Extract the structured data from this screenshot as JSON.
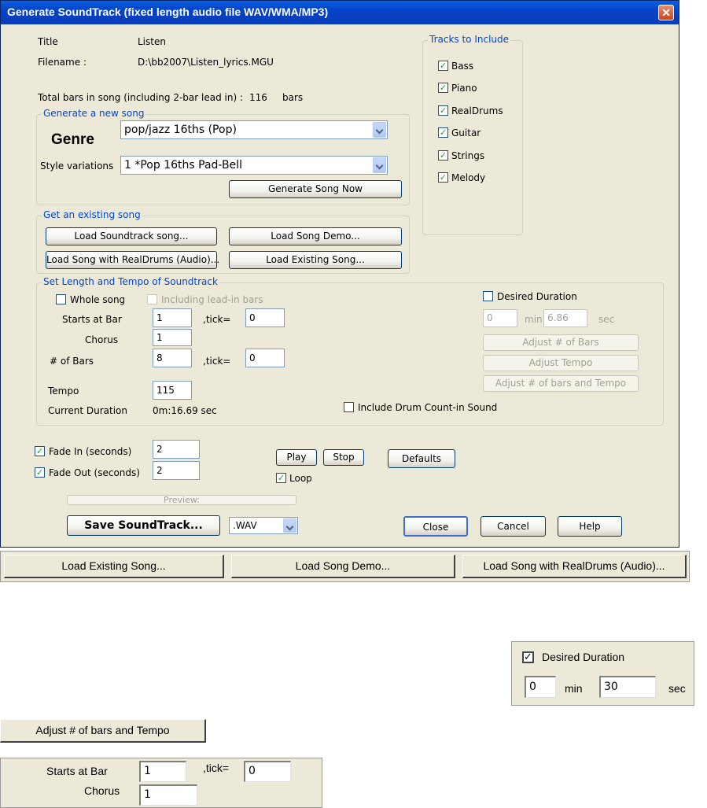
{
  "dialog": {
    "title": "Generate SoundTrack (fixed length audio file WAV/WMA/MP3)",
    "close_glyph": "✕",
    "title_label": "Title",
    "title_value": "Listen",
    "filename_label": "Filename :",
    "filename_value": "D:\\bb2007\\Listen_lyrics.MGU",
    "total_bars_label": "Total bars in song (including 2-bar lead in) :",
    "total_bars_value": "116",
    "total_bars_unit": "bars",
    "generate_group": {
      "legend": "Generate a new song",
      "genre_label": "Genre",
      "genre_value": "pop/jazz 16ths (Pop)",
      "style_label": "Style variations",
      "style_value": "1 *Pop 16ths Pad-Bell",
      "generate_button": "Generate Song Now"
    },
    "existing_group": {
      "legend": "Get an existing song",
      "load_soundtrack": "Load Soundtrack song...",
      "load_demo": "Load Song Demo...",
      "load_realdrums": "Load Song with RealDrums (Audio)...",
      "load_existing": "Load Existing Song..."
    },
    "tracks_group": {
      "legend": "Tracks to Include",
      "items": [
        {
          "label": "Bass",
          "checked": true
        },
        {
          "label": "Piano",
          "checked": true
        },
        {
          "label": "RealDrums",
          "checked": true
        },
        {
          "label": "Guitar",
          "checked": true
        },
        {
          "label": "Strings",
          "checked": true
        },
        {
          "label": "Melody",
          "checked": true
        }
      ]
    },
    "length_group": {
      "legend": "Set Length and Tempo of Soundtrack",
      "whole_song": "Whole song",
      "including_leadin": "Including lead-in bars",
      "starts_at_bar_label": "Starts at Bar",
      "starts_at_bar_value": "1",
      "tick_label": ",tick=",
      "tick_value_1": "0",
      "chorus_label": "Chorus",
      "chorus_value": "1",
      "bars_label": "# of Bars",
      "bars_value": "8",
      "tick_value_2": "0",
      "tempo_label": "Tempo",
      "tempo_value": "115",
      "current_duration_label": "Current Duration",
      "current_duration_value": "0m:16.69 sec",
      "desired_duration": "Desired Duration",
      "min_value": "0",
      "min_label": "min",
      "sec_value": "6.86",
      "sec_label": "sec",
      "adjust_bars": "Adjust # of Bars",
      "adjust_tempo": "Adjust Tempo",
      "adjust_both": "Adjust # of bars and Tempo",
      "include_drum": "Include Drum Count-in Sound"
    },
    "fade_in_label": "Fade In (seconds)",
    "fade_in_value": "2",
    "fade_out_label": "Fade Out  (seconds)",
    "fade_out_value": "2",
    "play": "Play",
    "stop": "Stop",
    "loop": "Loop",
    "defaults": "Defaults",
    "preview": "Preview:",
    "save": "Save SoundTrack...",
    "format_value": ".WAV",
    "close": "Close",
    "cancel": "Cancel",
    "help": "Help",
    "check_glyph": "✓"
  },
  "callouts": {
    "load_existing": "Load Existing Song...",
    "load_demo": "Load Song Demo...",
    "load_realdrums": "Load Song with RealDrums (Audio)...",
    "desired_duration": "Desired Duration",
    "min_value": "0",
    "min_label": "min",
    "sec_value": "30",
    "sec_label": "sec",
    "adjust_both": "Adjust # of bars and Tempo",
    "starts_at_bar_label": "Starts at Bar",
    "starts_at_bar_value": "1",
    "tick_label": ",tick=",
    "tick_value": "0",
    "chorus_label": "Chorus",
    "chorus_value": "1",
    "check_glyph": "✓"
  }
}
